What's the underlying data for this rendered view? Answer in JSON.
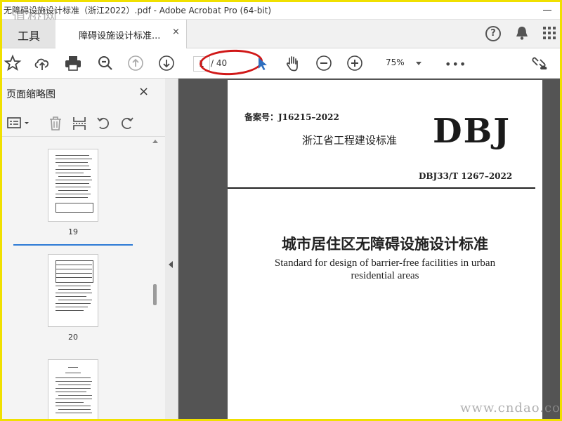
{
  "window": {
    "title": "无障碍设施设计标准（浙江2022）.pdf - Adobe Acrobat Pro (64-bit)",
    "watermark_top": "道桥网"
  },
  "tabs": {
    "tools": "工具",
    "document": "障碍设施设计标准...",
    "close": "×"
  },
  "toolbar": {
    "current_page": "1",
    "total_pages": "/ 40",
    "zoom": "75%",
    "more": "•••"
  },
  "panel": {
    "title": "页面缩略图",
    "close": "×",
    "thumbnails": [
      {
        "label": "19"
      },
      {
        "label": "20"
      },
      {
        "label": ""
      }
    ]
  },
  "document": {
    "record_no": "备案号：J16215–2022",
    "org": "浙江省工程建设标准",
    "logo": "DBJ",
    "code": "DBJ33/T 1267–2022",
    "title_cn": "城市居住区无障碍设施设计标准",
    "title_en_line1": "Standard for design of barrier-free facilities in urban",
    "title_en_line2": "residential areas"
  },
  "watermark_bottom": "www.cndao.com",
  "colors": {
    "highlight_circle": "#d01818",
    "frame": "#f0e000",
    "doc_bg": "#545454"
  }
}
